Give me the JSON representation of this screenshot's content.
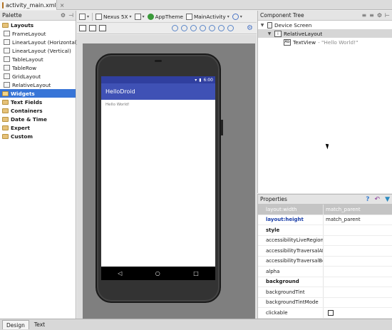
{
  "file_tab": {
    "name": "activity_main.xml",
    "close": "×"
  },
  "palette": {
    "title": "Palette",
    "items": [
      {
        "label": "Layouts",
        "kind": "category"
      },
      {
        "label": "FrameLayout",
        "kind": "widget"
      },
      {
        "label": "LinearLayout (Horizontal)",
        "kind": "widget"
      },
      {
        "label": "LinearLayout (Vertical)",
        "kind": "widget"
      },
      {
        "label": "TableLayout",
        "kind": "widget"
      },
      {
        "label": "TableRow",
        "kind": "widget"
      },
      {
        "label": "GridLayout",
        "kind": "widget"
      },
      {
        "label": "RelativeLayout",
        "kind": "widget"
      },
      {
        "label": "Widgets",
        "kind": "category",
        "selected": true
      },
      {
        "label": "Text Fields",
        "kind": "category"
      },
      {
        "label": "Containers",
        "kind": "category"
      },
      {
        "label": "Date & Time",
        "kind": "category"
      },
      {
        "label": "Expert",
        "kind": "category"
      },
      {
        "label": "Custom",
        "kind": "category"
      }
    ]
  },
  "toolbar": {
    "device": "Nexus 5X",
    "theme": "AppTheme",
    "activity": "MainActivity"
  },
  "phone": {
    "time": "6:00",
    "app_title": "HelloDroid",
    "hello_text": "Hello World!",
    "nav_back": "◁",
    "nav_home": "○",
    "nav_recent": "□"
  },
  "component_tree": {
    "title": "Component Tree",
    "device": "Device Screen",
    "layout": "RelativeLayout",
    "textview_name": "TextView",
    "textview_value": "- \"Hello World!\""
  },
  "properties": {
    "title": "Properties",
    "rows": [
      {
        "name": "layout:width",
        "value": "match_parent",
        "style": "hl"
      },
      {
        "name": "layout:height",
        "value": "match_parent",
        "style": "blue"
      },
      {
        "name": "style",
        "value": "",
        "style": "bold"
      },
      {
        "name": "accessibilityLiveRegion",
        "value": "",
        "style": ""
      },
      {
        "name": "accessibilityTraversalAfter",
        "value": "",
        "style": ""
      },
      {
        "name": "accessibilityTraversalBefore",
        "value": "",
        "style": ""
      },
      {
        "name": "alpha",
        "value": "",
        "style": ""
      },
      {
        "name": "background",
        "value": "",
        "style": "bold"
      },
      {
        "name": "backgroundTint",
        "value": "",
        "style": ""
      },
      {
        "name": "backgroundTintMode",
        "value": "",
        "style": ""
      },
      {
        "name": "clickable",
        "value": "",
        "style": "checkbox"
      }
    ]
  },
  "bottom_tabs": {
    "design": "Design",
    "text": "Text"
  },
  "colors": {
    "accent": "#3875d7",
    "app_bar": "#3f51b5",
    "status_bar": "#303f9f"
  }
}
